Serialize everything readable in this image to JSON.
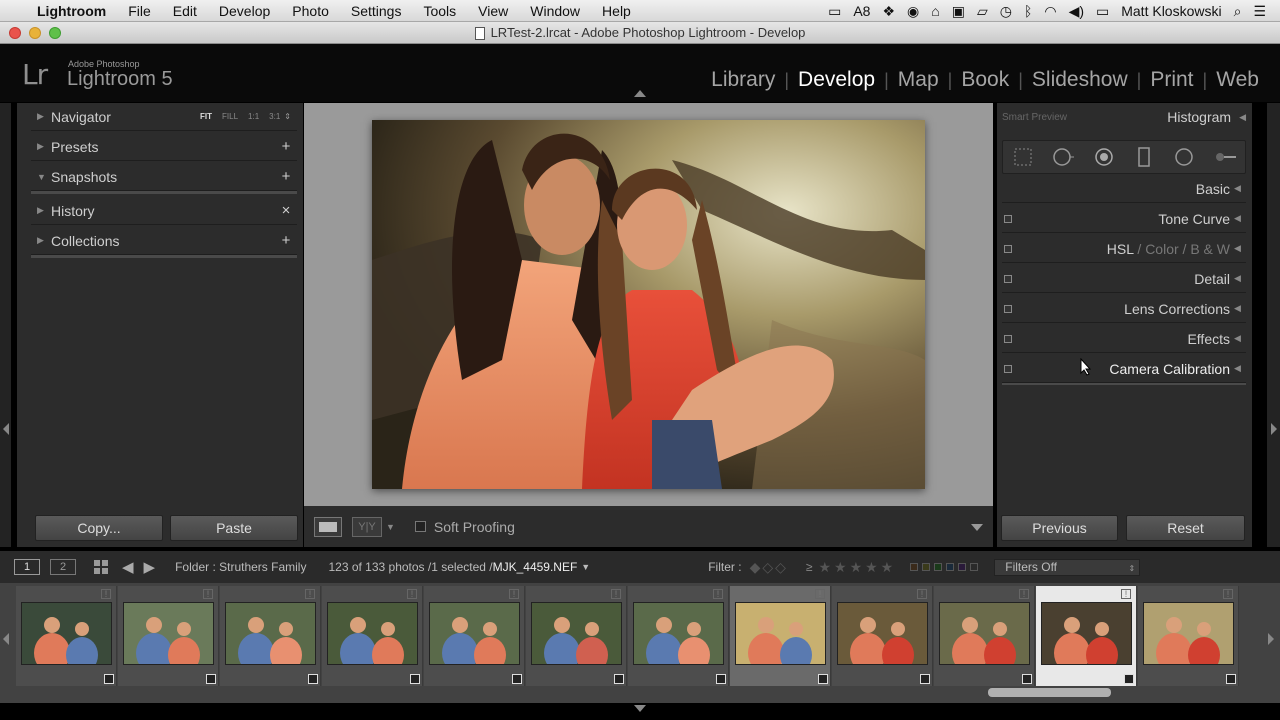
{
  "menubar": {
    "app": "Lightroom",
    "items": [
      "File",
      "Edit",
      "Develop",
      "Photo",
      "Settings",
      "Tools",
      "View",
      "Window",
      "Help"
    ],
    "status_badge": "8",
    "user": "Matt Kloskowski"
  },
  "window": {
    "title": "LRTest-2.lrcat - Adobe Photoshop Lightroom - Develop"
  },
  "identity": {
    "logo": "Lr",
    "brand_small": "Adobe Photoshop",
    "brand_name": "Lightroom",
    "version": "5"
  },
  "modules": [
    "Library",
    "Develop",
    "Map",
    "Book",
    "Slideshow",
    "Print",
    "Web"
  ],
  "active_module": "Develop",
  "left_panel": {
    "navigator": {
      "label": "Navigator",
      "options": [
        "FIT",
        "FILL",
        "1:1",
        "3:1"
      ],
      "selected": "FIT"
    },
    "presets": {
      "label": "Presets",
      "action": "+"
    },
    "snapshots": {
      "label": "Snapshots",
      "action": "+"
    },
    "history": {
      "label": "History",
      "action": "×"
    },
    "collections": {
      "label": "Collections",
      "action": "+"
    },
    "copy_label": "Copy...",
    "paste_label": "Paste"
  },
  "toolbar": {
    "yy_label": "Y|Y",
    "soft_proofing": "Soft Proofing"
  },
  "right_panel": {
    "smart_preview": "Smart Preview",
    "histogram": "Histogram",
    "basic": "Basic",
    "tone_curve": "Tone Curve",
    "hsl": "HSL",
    "slash1": "/",
    "color": "Color",
    "slash2": "/",
    "bw": "B & W",
    "detail": "Detail",
    "lens_corrections": "Lens Corrections",
    "effects": "Effects",
    "camera_calibration": "Camera Calibration",
    "previous_label": "Previous",
    "reset_label": "Reset"
  },
  "filmstrip_bar": {
    "screen1": "1",
    "screen2": "2",
    "folder": "Folder : Struthers Family",
    "count": "123 of 133 photos /1 selected /",
    "filename": "MJK_4459.NEF",
    "filter_label": "Filter :",
    "gte": "≥",
    "filters_off": "Filters Off"
  },
  "filmstrip": {
    "thumb_count": 12,
    "selected_index": 10,
    "highlighted_index": 7
  },
  "colors": {
    "accent_active": "#ffffff",
    "panel_bg": "#2c2c2c",
    "center_bg": "#9a9a9a"
  }
}
